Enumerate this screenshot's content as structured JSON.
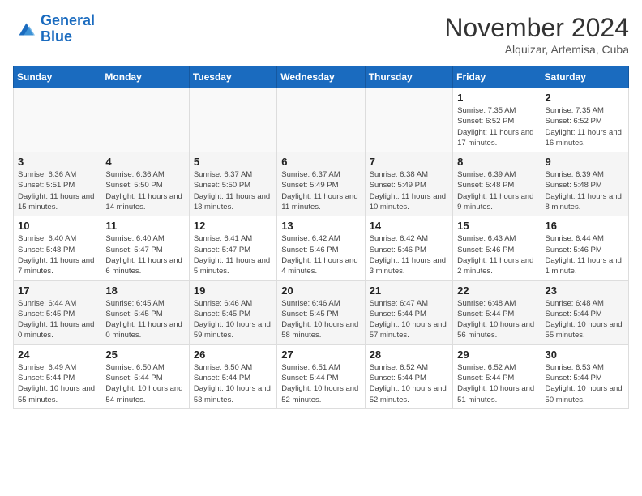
{
  "header": {
    "logo_line1": "General",
    "logo_line2": "Blue",
    "title": "November 2024",
    "subtitle": "Alquizar, Artemisa, Cuba"
  },
  "weekdays": [
    "Sunday",
    "Monday",
    "Tuesday",
    "Wednesday",
    "Thursday",
    "Friday",
    "Saturday"
  ],
  "weeks": [
    [
      {
        "day": "",
        "info": ""
      },
      {
        "day": "",
        "info": ""
      },
      {
        "day": "",
        "info": ""
      },
      {
        "day": "",
        "info": ""
      },
      {
        "day": "",
        "info": ""
      },
      {
        "day": "1",
        "info": "Sunrise: 7:35 AM\nSunset: 6:52 PM\nDaylight: 11 hours and 17 minutes."
      },
      {
        "day": "2",
        "info": "Sunrise: 7:35 AM\nSunset: 6:52 PM\nDaylight: 11 hours and 16 minutes."
      }
    ],
    [
      {
        "day": "3",
        "info": "Sunrise: 6:36 AM\nSunset: 5:51 PM\nDaylight: 11 hours and 15 minutes."
      },
      {
        "day": "4",
        "info": "Sunrise: 6:36 AM\nSunset: 5:50 PM\nDaylight: 11 hours and 14 minutes."
      },
      {
        "day": "5",
        "info": "Sunrise: 6:37 AM\nSunset: 5:50 PM\nDaylight: 11 hours and 13 minutes."
      },
      {
        "day": "6",
        "info": "Sunrise: 6:37 AM\nSunset: 5:49 PM\nDaylight: 11 hours and 11 minutes."
      },
      {
        "day": "7",
        "info": "Sunrise: 6:38 AM\nSunset: 5:49 PM\nDaylight: 11 hours and 10 minutes."
      },
      {
        "day": "8",
        "info": "Sunrise: 6:39 AM\nSunset: 5:48 PM\nDaylight: 11 hours and 9 minutes."
      },
      {
        "day": "9",
        "info": "Sunrise: 6:39 AM\nSunset: 5:48 PM\nDaylight: 11 hours and 8 minutes."
      }
    ],
    [
      {
        "day": "10",
        "info": "Sunrise: 6:40 AM\nSunset: 5:48 PM\nDaylight: 11 hours and 7 minutes."
      },
      {
        "day": "11",
        "info": "Sunrise: 6:40 AM\nSunset: 5:47 PM\nDaylight: 11 hours and 6 minutes."
      },
      {
        "day": "12",
        "info": "Sunrise: 6:41 AM\nSunset: 5:47 PM\nDaylight: 11 hours and 5 minutes."
      },
      {
        "day": "13",
        "info": "Sunrise: 6:42 AM\nSunset: 5:46 PM\nDaylight: 11 hours and 4 minutes."
      },
      {
        "day": "14",
        "info": "Sunrise: 6:42 AM\nSunset: 5:46 PM\nDaylight: 11 hours and 3 minutes."
      },
      {
        "day": "15",
        "info": "Sunrise: 6:43 AM\nSunset: 5:46 PM\nDaylight: 11 hours and 2 minutes."
      },
      {
        "day": "16",
        "info": "Sunrise: 6:44 AM\nSunset: 5:46 PM\nDaylight: 11 hours and 1 minute."
      }
    ],
    [
      {
        "day": "17",
        "info": "Sunrise: 6:44 AM\nSunset: 5:45 PM\nDaylight: 11 hours and 0 minutes."
      },
      {
        "day": "18",
        "info": "Sunrise: 6:45 AM\nSunset: 5:45 PM\nDaylight: 11 hours and 0 minutes."
      },
      {
        "day": "19",
        "info": "Sunrise: 6:46 AM\nSunset: 5:45 PM\nDaylight: 10 hours and 59 minutes."
      },
      {
        "day": "20",
        "info": "Sunrise: 6:46 AM\nSunset: 5:45 PM\nDaylight: 10 hours and 58 minutes."
      },
      {
        "day": "21",
        "info": "Sunrise: 6:47 AM\nSunset: 5:44 PM\nDaylight: 10 hours and 57 minutes."
      },
      {
        "day": "22",
        "info": "Sunrise: 6:48 AM\nSunset: 5:44 PM\nDaylight: 10 hours and 56 minutes."
      },
      {
        "day": "23",
        "info": "Sunrise: 6:48 AM\nSunset: 5:44 PM\nDaylight: 10 hours and 55 minutes."
      }
    ],
    [
      {
        "day": "24",
        "info": "Sunrise: 6:49 AM\nSunset: 5:44 PM\nDaylight: 10 hours and 55 minutes."
      },
      {
        "day": "25",
        "info": "Sunrise: 6:50 AM\nSunset: 5:44 PM\nDaylight: 10 hours and 54 minutes."
      },
      {
        "day": "26",
        "info": "Sunrise: 6:50 AM\nSunset: 5:44 PM\nDaylight: 10 hours and 53 minutes."
      },
      {
        "day": "27",
        "info": "Sunrise: 6:51 AM\nSunset: 5:44 PM\nDaylight: 10 hours and 52 minutes."
      },
      {
        "day": "28",
        "info": "Sunrise: 6:52 AM\nSunset: 5:44 PM\nDaylight: 10 hours and 52 minutes."
      },
      {
        "day": "29",
        "info": "Sunrise: 6:52 AM\nSunset: 5:44 PM\nDaylight: 10 hours and 51 minutes."
      },
      {
        "day": "30",
        "info": "Sunrise: 6:53 AM\nSunset: 5:44 PM\nDaylight: 10 hours and 50 minutes."
      }
    ]
  ]
}
